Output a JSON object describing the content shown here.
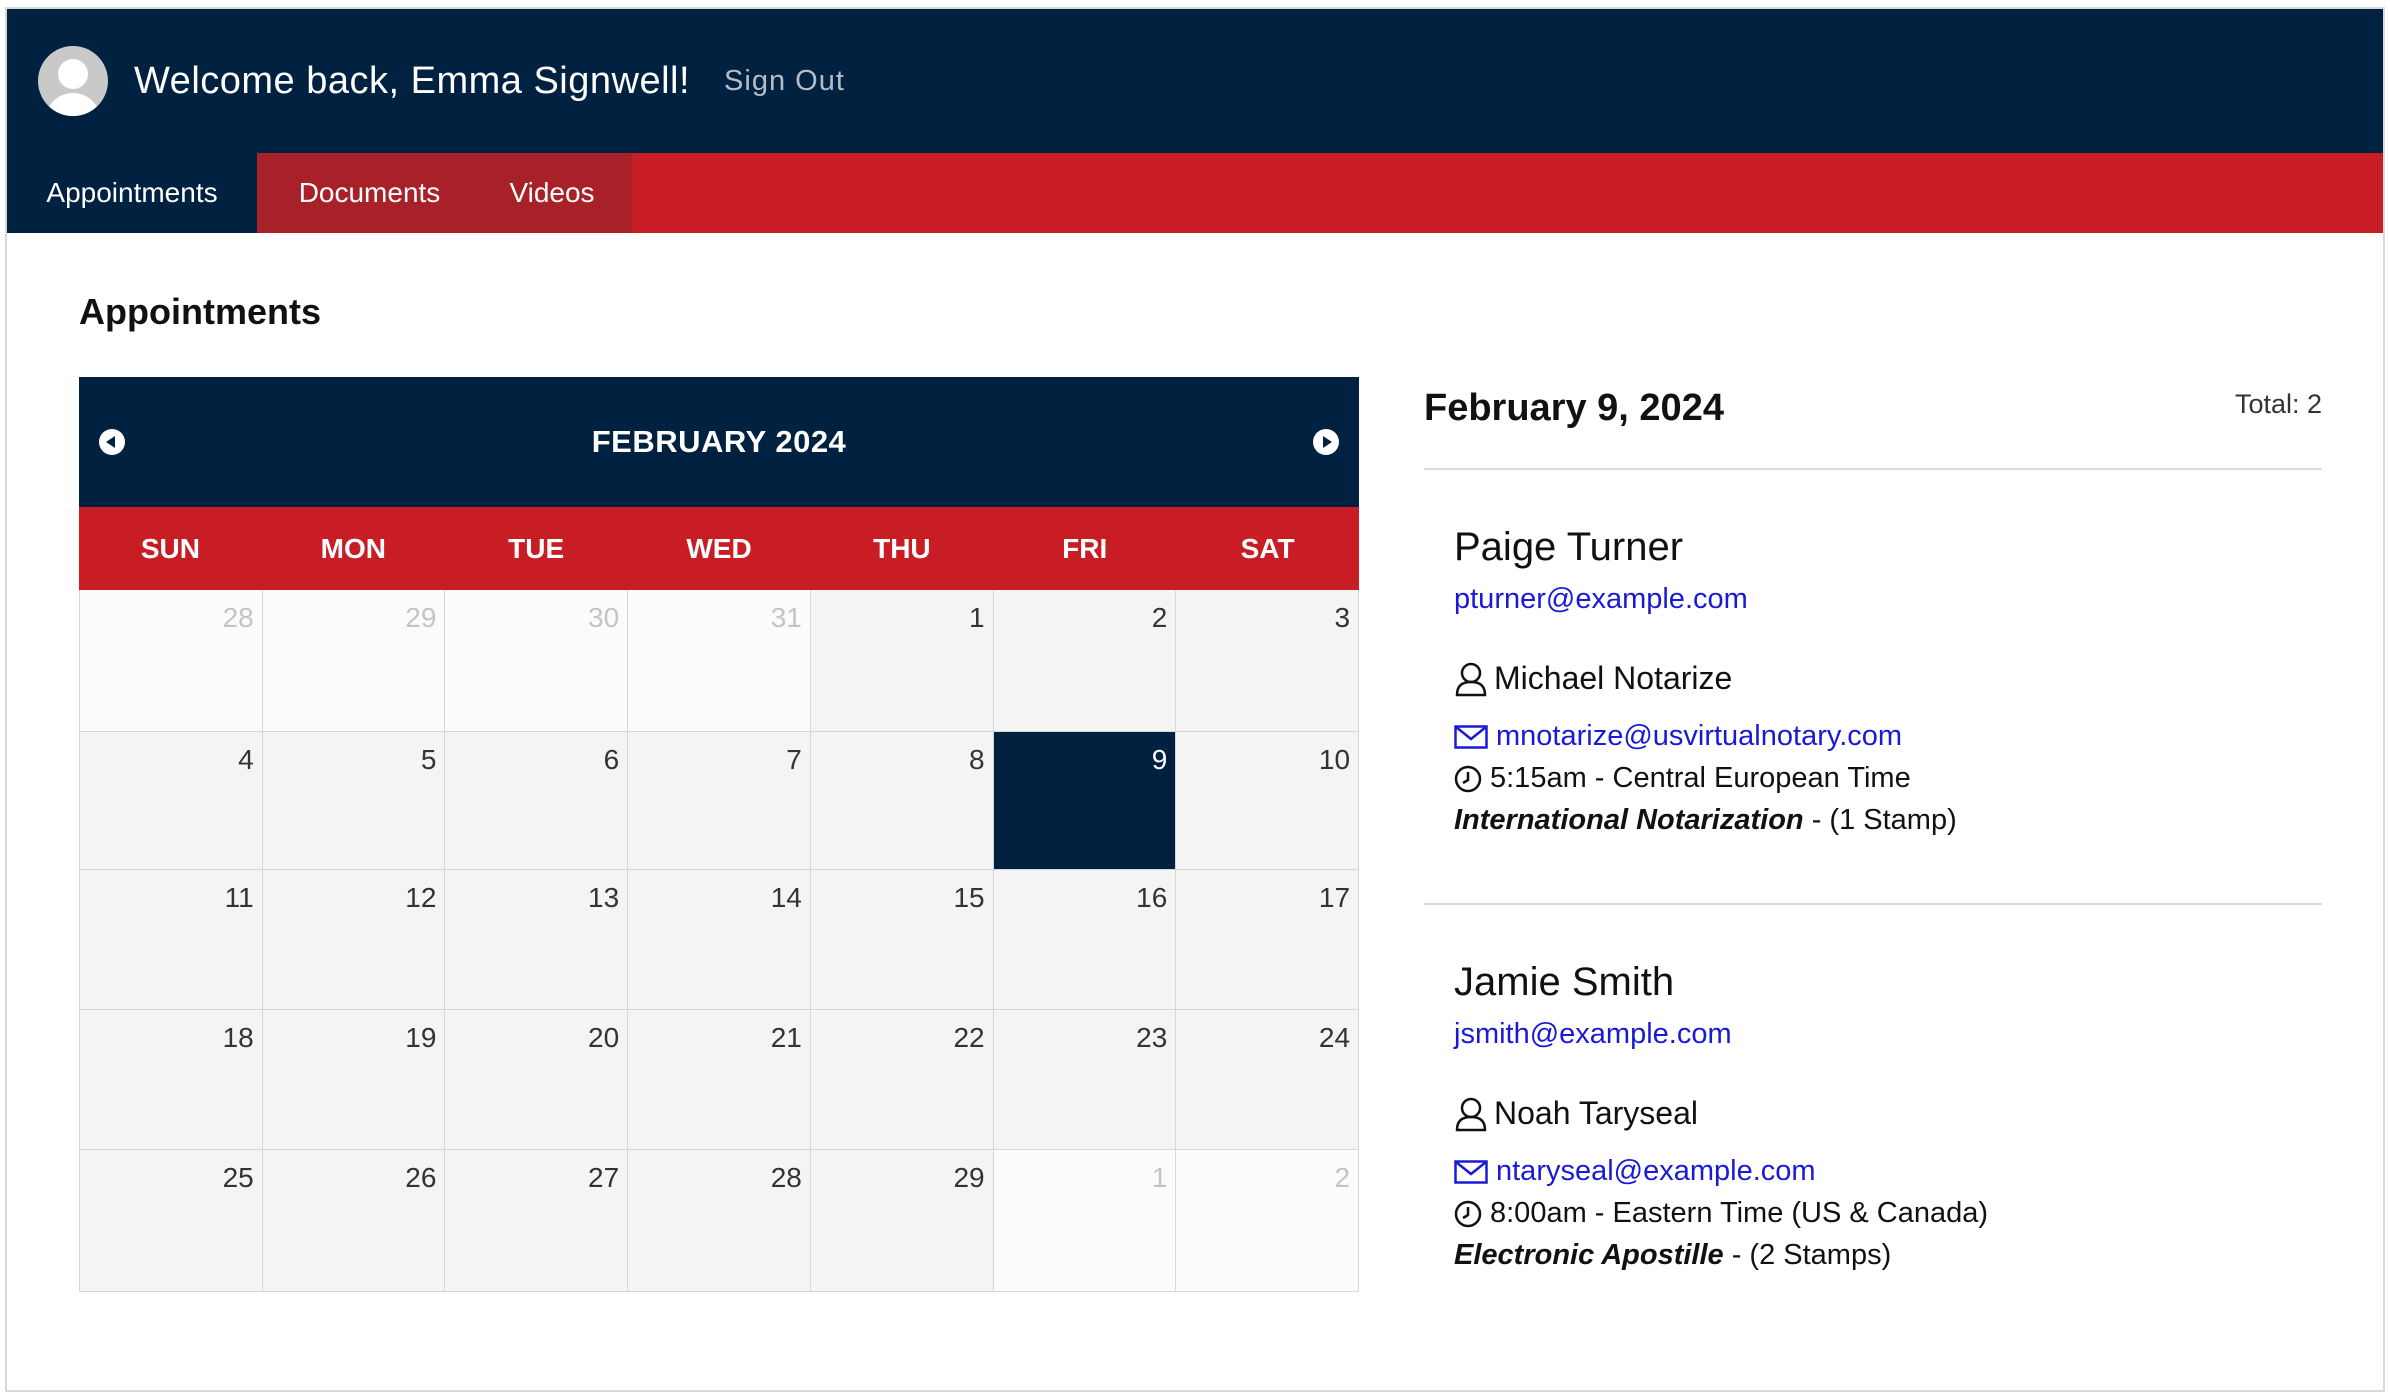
{
  "header": {
    "welcome": "Welcome back, Emma Signwell!",
    "signout": "Sign Out"
  },
  "nav": {
    "tabs": [
      {
        "label": "Appointments",
        "active": true
      },
      {
        "label": "Documents",
        "active": false
      },
      {
        "label": "Videos",
        "active": false
      }
    ]
  },
  "page": {
    "title": "Appointments"
  },
  "calendar": {
    "title": "FEBRUARY 2024",
    "days_of_week": [
      "SUN",
      "MON",
      "TUE",
      "WED",
      "THU",
      "FRI",
      "SAT"
    ],
    "weeks": [
      [
        {
          "n": "28",
          "m": true
        },
        {
          "n": "29",
          "m": true
        },
        {
          "n": "30",
          "m": true
        },
        {
          "n": "31",
          "m": true
        },
        {
          "n": "1"
        },
        {
          "n": "2"
        },
        {
          "n": "3"
        }
      ],
      [
        {
          "n": "4"
        },
        {
          "n": "5"
        },
        {
          "n": "6"
        },
        {
          "n": "7"
        },
        {
          "n": "8"
        },
        {
          "n": "9",
          "s": true
        },
        {
          "n": "10"
        }
      ],
      [
        {
          "n": "11"
        },
        {
          "n": "12"
        },
        {
          "n": "13"
        },
        {
          "n": "14"
        },
        {
          "n": "15"
        },
        {
          "n": "16"
        },
        {
          "n": "17"
        }
      ],
      [
        {
          "n": "18"
        },
        {
          "n": "19"
        },
        {
          "n": "20"
        },
        {
          "n": "21"
        },
        {
          "n": "22"
        },
        {
          "n": "23"
        },
        {
          "n": "24"
        }
      ],
      [
        {
          "n": "25"
        },
        {
          "n": "26"
        },
        {
          "n": "27"
        },
        {
          "n": "28"
        },
        {
          "n": "29"
        },
        {
          "n": "1",
          "m": true
        },
        {
          "n": "2",
          "m": true
        }
      ]
    ]
  },
  "detail": {
    "date": "February 9, 2024",
    "total": "Total: 2",
    "appointments": [
      {
        "client_name": "Paige Turner",
        "client_email": "pturner@example.com",
        "notary_name": "Michael Notarize",
        "notary_email": "mnotarize@usvirtualnotary.com",
        "time": "5:15am - Central European Time",
        "service": "International Notarization",
        "stamps": " - (1 Stamp)"
      },
      {
        "client_name": "Jamie Smith",
        "client_email": "jsmith@example.com",
        "notary_name": "Noah Taryseal",
        "notary_email": "ntaryseal@example.com",
        "time": "8:00am - Eastern Time (US & Canada)",
        "service": "Electronic Apostille",
        "stamps": " - (2 Stamps)"
      }
    ]
  },
  "icons": {
    "avatar": "user-avatar-icon",
    "prev": "chevron-left-circle-icon",
    "next": "chevron-right-circle-icon",
    "notary": "person-outline-icon",
    "email": "envelope-icon",
    "time": "clock-icon"
  },
  "colors": {
    "navy": "#002240",
    "red": "#c81d25",
    "link": "#1a1ad6"
  }
}
